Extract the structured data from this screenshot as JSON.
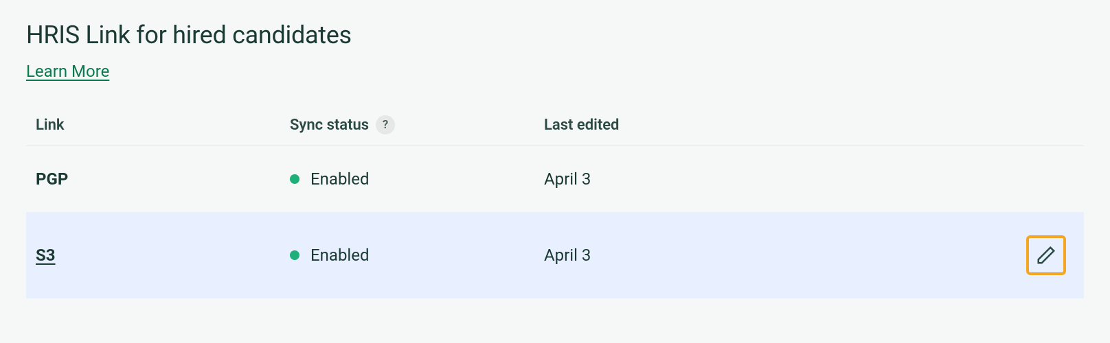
{
  "header": {
    "title": "HRIS Link for hired candidates",
    "learn_more": "Learn More"
  },
  "table": {
    "columns": {
      "link": "Link",
      "sync_status": "Sync status",
      "last_edited": "Last edited"
    },
    "help_glyph": "?",
    "rows": [
      {
        "name": "PGP",
        "status": "Enabled",
        "status_color": "#1fb07a",
        "last_edited": "April 3",
        "highlighted": false,
        "underlined": false,
        "show_edit": false
      },
      {
        "name": "S3",
        "status": "Enabled",
        "status_color": "#1fb07a",
        "last_edited": "April 3",
        "highlighted": true,
        "underlined": true,
        "show_edit": true
      }
    ]
  },
  "colors": {
    "text_dark": "#1a3a33",
    "accent_green": "#0a7a4e",
    "status_green": "#1fb07a",
    "highlight_bg": "#e8f0ff",
    "edit_border": "#f5a623"
  }
}
